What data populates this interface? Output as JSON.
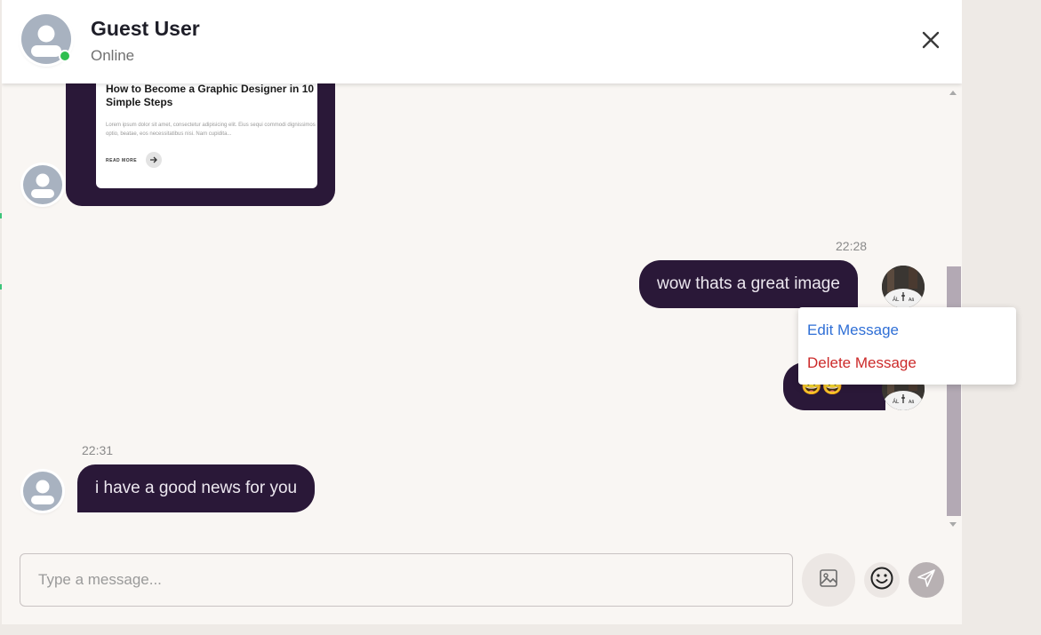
{
  "header": {
    "name": "Guest User",
    "status": "Online",
    "online_color": "#2fbf4f"
  },
  "shared_post": {
    "title": "How to Become a Graphic Designer in 10 Simple Steps",
    "body": "Lorem ipsum dolor sit amet, consectetur adipisicing elit. Eius sequi commodi dignissimos optio, beatae, eos necessitatibus nisi. Nam cupidita...",
    "read_more": "READ MORE"
  },
  "messages": [
    {
      "time": "22:28",
      "text": "wow thats a great image",
      "direction": "outgoing"
    },
    {
      "text": "😀😀",
      "direction": "outgoing"
    },
    {
      "time": "22:31",
      "text": "i have a good news for you",
      "direction": "incoming"
    }
  ],
  "context_menu": {
    "edit": "Edit Message",
    "delete": "Delete Message"
  },
  "composer": {
    "placeholder": "Type a message..."
  },
  "colors": {
    "bubble": "#2a1838",
    "background": "#f9f6f3",
    "edit": "#2f6fd6",
    "delete": "#cc2a2a"
  }
}
